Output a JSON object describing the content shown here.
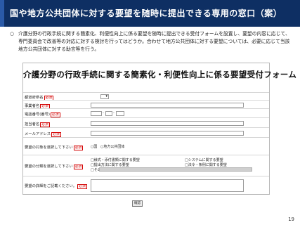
{
  "header": {
    "title": "国や地方公共団体に対する要望を随時に提出できる専用の窓口（案）"
  },
  "intro": {
    "bullet": "○",
    "text": "介護分野の行政手続に関する簡素化、利便性向上に係る要望を随時に提出できる受付フォームを設置し、要望の内容に応じて、専門委員会で改善等の対応に対する検討を行ってはどうか。合わせて地方公共団体に対する要望については、必要に応じて当該地方公共団体に対する助言等を行う。"
  },
  "form": {
    "title": "介護分野の行政手続に関する簡素化・利便性向上に係る要望受付フォーム",
    "required_mark": "必須",
    "fields": {
      "prefecture": {
        "label": "都道府県名"
      },
      "office": {
        "label": "事業者名"
      },
      "phone": {
        "label": "電話番号(番号)",
        "separator": "-"
      },
      "person": {
        "label": "担当者名"
      },
      "email": {
        "label": "メールアドレス"
      },
      "target": {
        "label": "要望の対象を選択して下さい",
        "options": [
          "国",
          "地方公共団体"
        ]
      },
      "category": {
        "label": "要望の分類を選択して下さい",
        "options": [
          "様式・添付書類に関する要望",
          "システムに関する要望",
          "提出方法に関する要望",
          "法令・条例に関する要望",
          "その他"
        ]
      },
      "details": {
        "label": "要望の詳細をご記載ください。"
      }
    },
    "submit_label": "確認"
  },
  "page_number": "19"
}
